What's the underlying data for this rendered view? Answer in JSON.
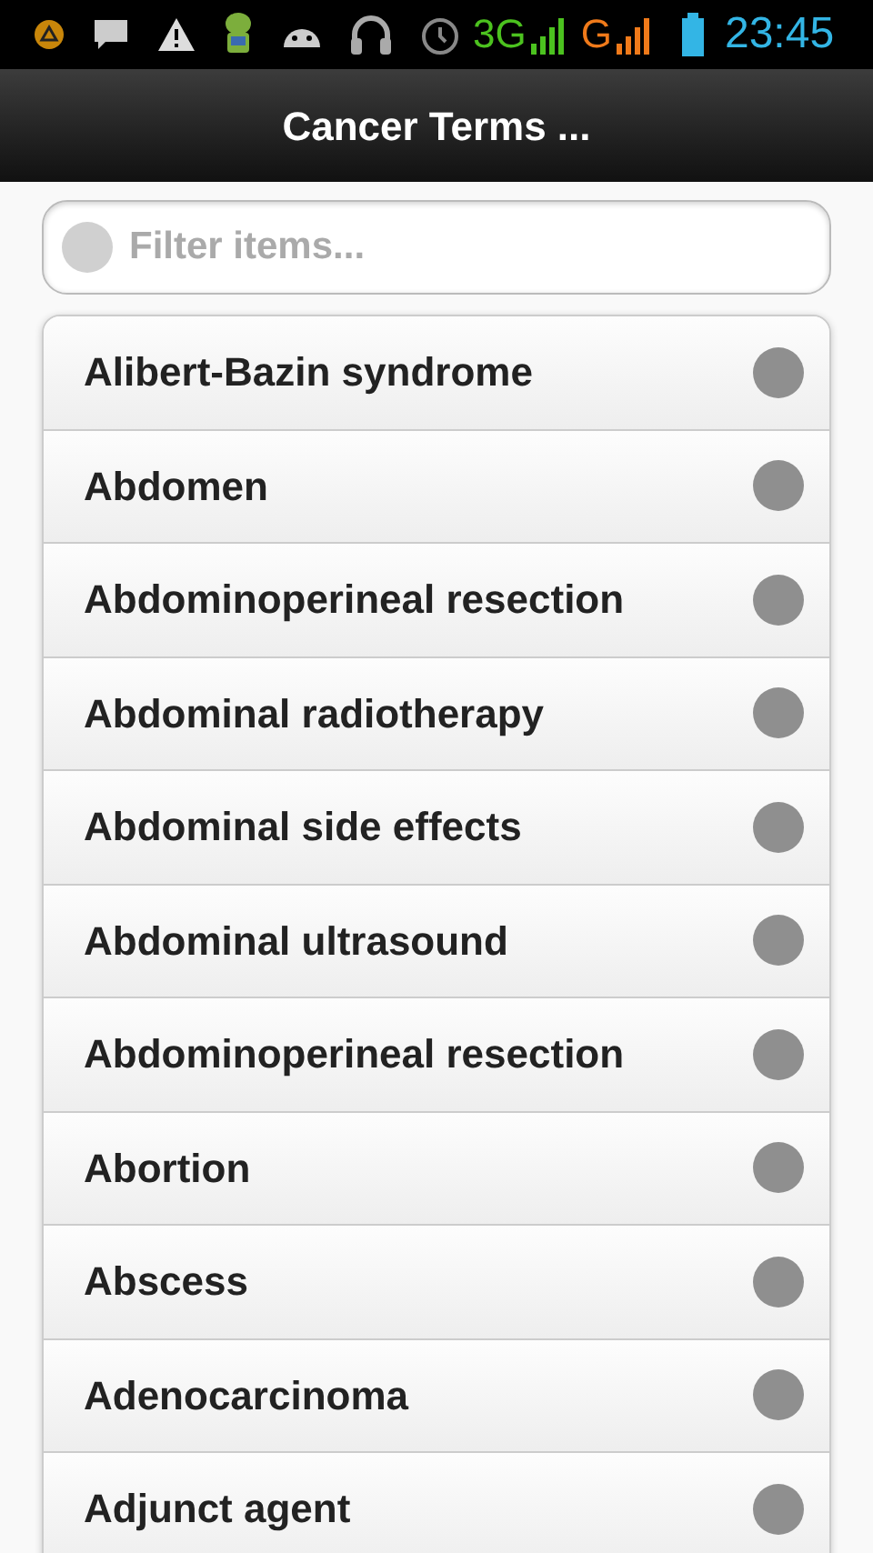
{
  "status_bar": {
    "network_3g": "3G",
    "network_g": "G",
    "time": "23:45"
  },
  "header": {
    "title": "Cancer Terms ..."
  },
  "search": {
    "placeholder": "Filter items..."
  },
  "items": [
    {
      "label": "Alibert-Bazin syndrome"
    },
    {
      "label": "Abdomen"
    },
    {
      "label": "Abdominoperineal resection"
    },
    {
      "label": "Abdominal radiotherapy"
    },
    {
      "label": "Abdominal side effects"
    },
    {
      "label": "Abdominal ultrasound"
    },
    {
      "label": "Abdominoperineal resection"
    },
    {
      "label": "Abortion"
    },
    {
      "label": "Abscess"
    },
    {
      "label": "Adenocarcinoma"
    },
    {
      "label": "Adjunct agent"
    }
  ]
}
